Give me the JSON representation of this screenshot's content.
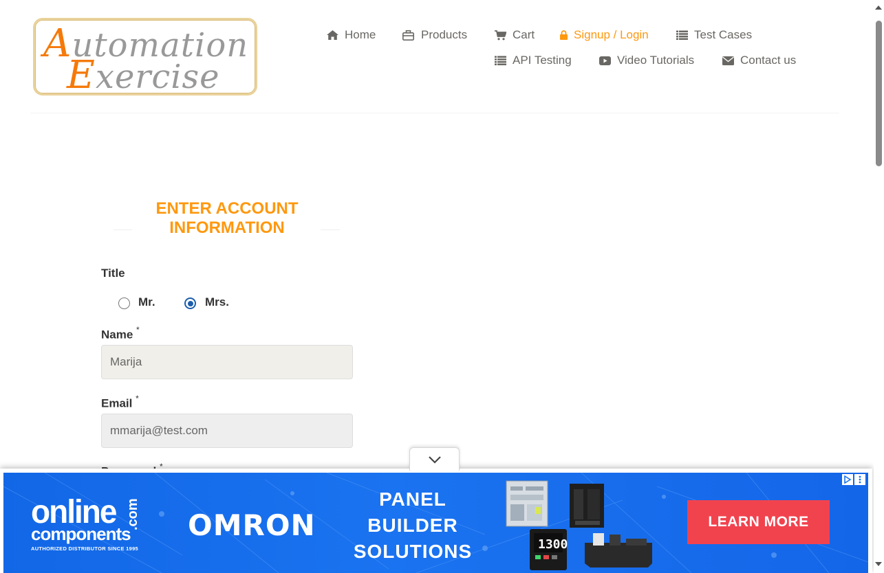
{
  "logo": {
    "line1_cap": "A",
    "line1_rest": "utomation",
    "line2_cap": "E",
    "line2_rest": "xercise"
  },
  "nav": {
    "items": [
      {
        "label": "Home",
        "icon": "home-icon"
      },
      {
        "label": "Products",
        "icon": "briefcase-icon"
      },
      {
        "label": "Cart",
        "icon": "cart-icon"
      },
      {
        "label": "Signup / Login",
        "icon": "lock-icon",
        "active": true
      },
      {
        "label": "Test Cases",
        "icon": "list-icon"
      },
      {
        "label": "API Testing",
        "icon": "list-icon"
      },
      {
        "label": "Video Tutorials",
        "icon": "youtube-icon"
      },
      {
        "label": "Contact us",
        "icon": "envelope-icon"
      }
    ],
    "active_color": "#fe980f"
  },
  "form": {
    "title_line1": "ENTER ACCOUNT",
    "title_line2": "INFORMATION",
    "title_label": "Title",
    "title_options": [
      {
        "label": "Mr.",
        "checked": false
      },
      {
        "label": "Mrs.",
        "checked": true
      }
    ],
    "name_label": "Name",
    "name_value": "Marija",
    "email_label": "Email",
    "email_value": "mmarija@test.com",
    "password_label": "Password",
    "required_mark": "*"
  },
  "ad": {
    "brand_line1": "online",
    "brand_line2": "components",
    "brand_com": ".com",
    "brand_tagline": "AUTHORIZED DISTRIBUTOR SINCE 1995",
    "partner": "OMRON",
    "headline_1": "PANEL",
    "headline_2": "BUILDER",
    "headline_3": "SOLUTIONS",
    "cta": "LEARN MORE",
    "device_readout": "1300",
    "bg_color": "#1a73f0",
    "cta_color": "#f1434e"
  }
}
